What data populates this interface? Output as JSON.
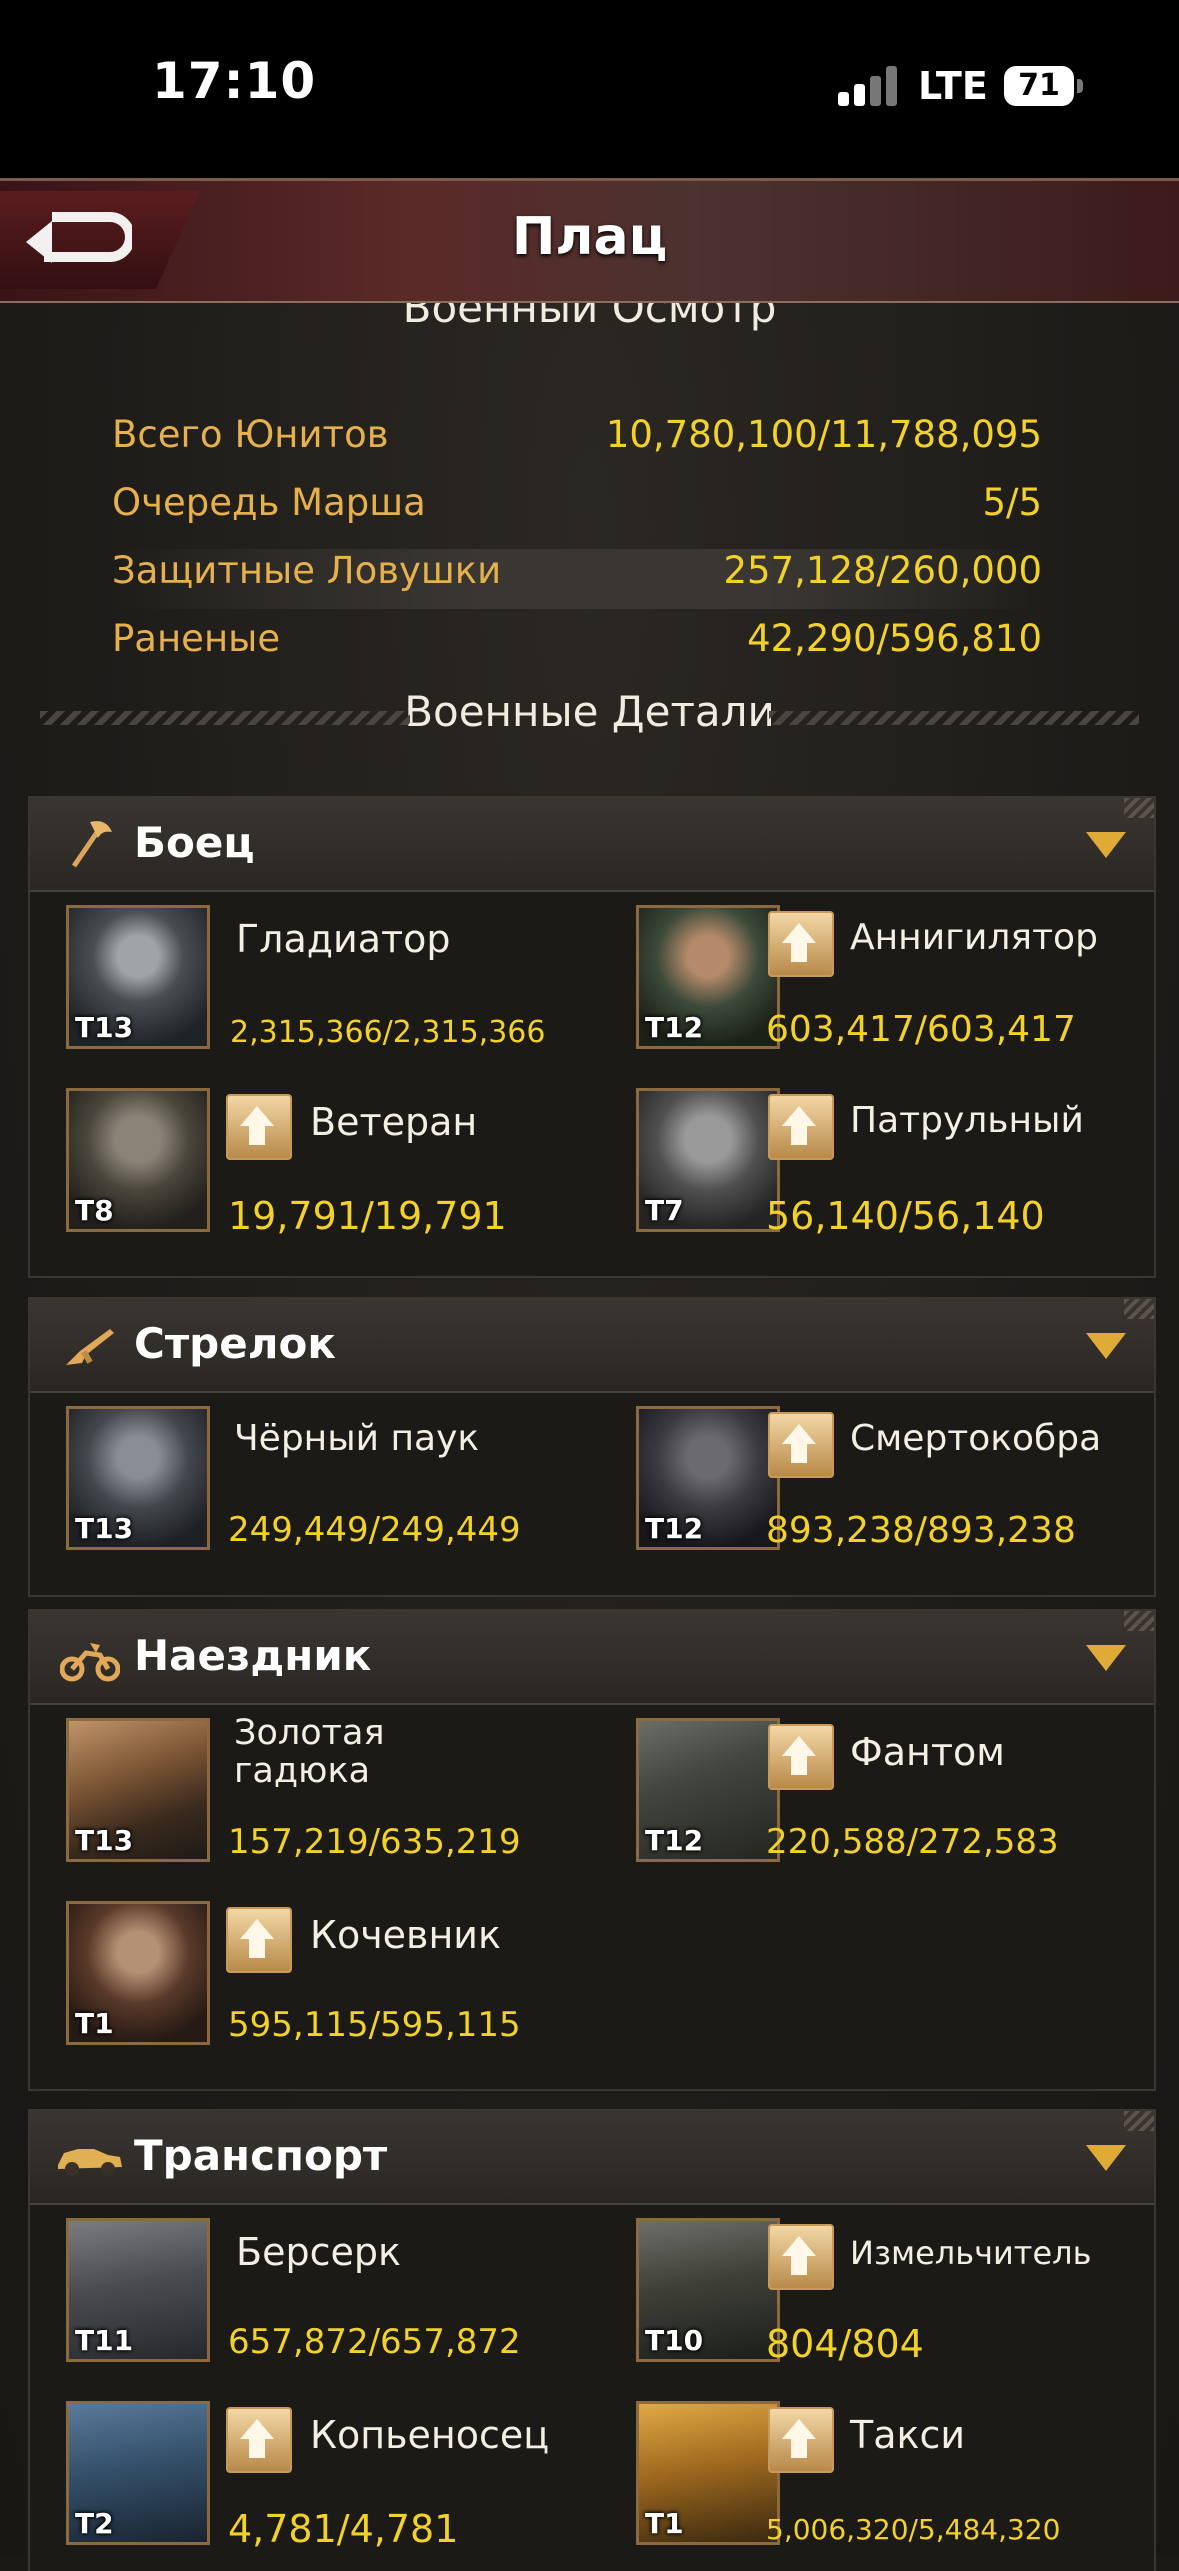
{
  "status_bar": {
    "time": "17:10",
    "network": "LTE",
    "battery": "71"
  },
  "header": {
    "title": "Плац"
  },
  "inspection": {
    "heading": "Военный Осмотр",
    "rows": [
      {
        "label": "Всего Юнитов",
        "value": "10,780,100/11,788,095"
      },
      {
        "label": "Очередь Марша",
        "value": "5/5"
      },
      {
        "label": "Защитные Ловушки",
        "value": "257,128/260,000"
      },
      {
        "label": "Раненые",
        "value": "42,290/596,810"
      }
    ]
  },
  "details": {
    "heading": "Военные Детали",
    "categories": [
      {
        "name": "Боец",
        "icon": "axe-icon",
        "units": [
          {
            "name": "Гладиатор",
            "tier": "T13",
            "count": "2,315,366/2,315,366",
            "upgrade": false
          },
          {
            "name": "Аннигилятор",
            "tier": "T12",
            "count": "603,417/603,417",
            "upgrade": true
          },
          {
            "name": "Ветеран",
            "tier": "T8",
            "count": "19,791/19,791",
            "upgrade": true
          },
          {
            "name": "Патрульный",
            "tier": "T7",
            "count": "56,140/56,140",
            "upgrade": true
          }
        ]
      },
      {
        "name": "Стрелок",
        "icon": "rifle-icon",
        "units": [
          {
            "name": "Чёрный паук",
            "tier": "T13",
            "count": "249,449/249,449",
            "upgrade": false
          },
          {
            "name": "Смертокобра",
            "tier": "T12",
            "count": "893,238/893,238",
            "upgrade": true
          }
        ]
      },
      {
        "name": "Наездник",
        "icon": "motorcycle-icon",
        "units": [
          {
            "name": "Золотая гадюка",
            "tier": "T13",
            "count": "157,219/635,219",
            "upgrade": false
          },
          {
            "name": "Фантом",
            "tier": "T12",
            "count": "220,588/272,583",
            "upgrade": true
          },
          {
            "name": "Кочевник",
            "tier": "T1",
            "count": "595,115/595,115",
            "upgrade": true
          }
        ]
      },
      {
        "name": "Транспорт",
        "icon": "car-icon",
        "units": [
          {
            "name": "Берсерк",
            "tier": "T11",
            "count": "657,872/657,872",
            "upgrade": false
          },
          {
            "name": "Измельчитель",
            "tier": "T10",
            "count": "804/804",
            "upgrade": true
          },
          {
            "name": "Копьеносец",
            "tier": "T2",
            "count": "4,781/4,781",
            "upgrade": true
          },
          {
            "name": "Такси",
            "tier": "T1",
            "count": "5,006,320/5,484,320",
            "upgrade": true
          }
        ]
      }
    ]
  }
}
